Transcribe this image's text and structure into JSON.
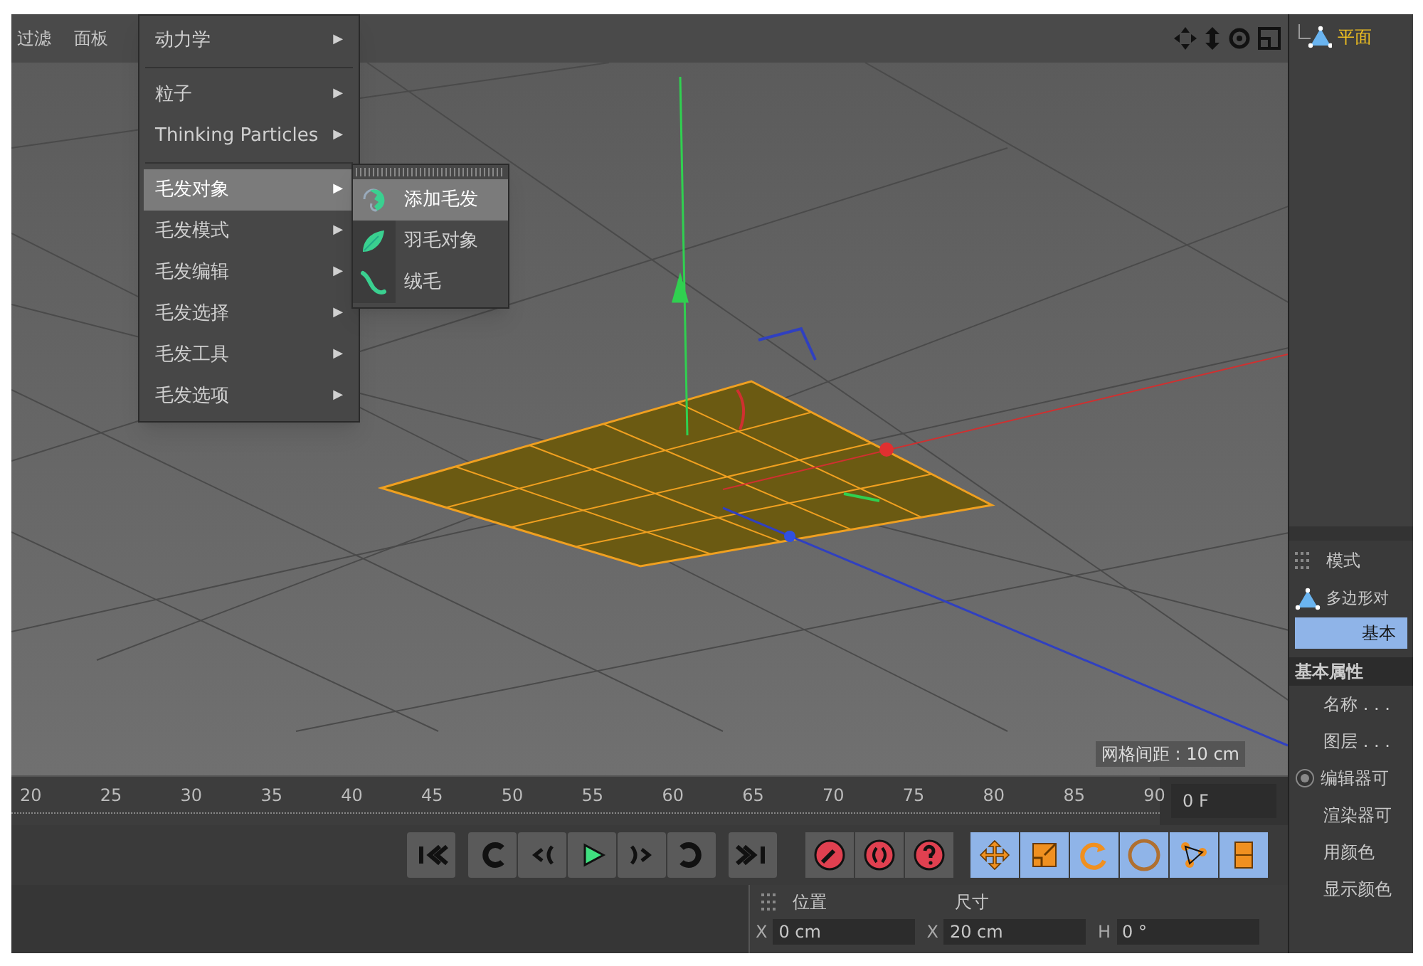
{
  "viewport": {
    "menu": [
      "过滤",
      "面板"
    ],
    "grid_spacing": "网格间距 : 10 cm"
  },
  "menu": {
    "groups": [
      [
        {
          "label": "动力学",
          "selected": false
        }
      ],
      [
        {
          "label": "粒子",
          "selected": false
        },
        {
          "label": "Thinking Particles",
          "selected": false
        }
      ],
      [
        {
          "label": "毛发对象",
          "selected": true
        },
        {
          "label": "毛发模式",
          "selected": false
        },
        {
          "label": "毛发编辑",
          "selected": false
        },
        {
          "label": "毛发选择",
          "selected": false
        },
        {
          "label": "毛发工具",
          "selected": false
        },
        {
          "label": "毛发选项",
          "selected": false
        }
      ]
    ],
    "arrow": "▶"
  },
  "submenu": [
    {
      "label": "添加毛发",
      "kind": "hair",
      "selected": true
    },
    {
      "label": "羽毛对象",
      "kind": "feather",
      "selected": false
    },
    {
      "label": "绒毛",
      "kind": "fur",
      "selected": false
    }
  ],
  "object_list": [
    {
      "label": "平面",
      "selected": true
    }
  ],
  "attributes": {
    "tab": "模式",
    "object": "多边形对",
    "tabs": [
      {
        "label": "基本",
        "selected": true
      }
    ],
    "section": "基本属性",
    "fields": [
      {
        "label": "名称 . . .",
        "kind": "text"
      },
      {
        "label": "图层 . . .",
        "kind": "text"
      },
      {
        "label": "编辑器可",
        "kind": "radio",
        "checked": true
      },
      {
        "label": "渲染器可",
        "kind": "text"
      },
      {
        "label": "用颜色",
        "kind": "text"
      },
      {
        "label": "显示颜色",
        "kind": "text"
      }
    ]
  },
  "timeline": {
    "ticks": [
      "20",
      "25",
      "30",
      "35",
      "40",
      "45",
      "50",
      "55",
      "60",
      "65",
      "70",
      "75",
      "80",
      "85",
      "90"
    ],
    "frame": "0 F"
  },
  "transport": [
    {
      "kind": "first"
    },
    {
      "kind": "prev_key"
    },
    {
      "kind": "prev_frame"
    },
    {
      "kind": "play"
    },
    {
      "kind": "next_frame"
    },
    {
      "kind": "next_key"
    },
    {
      "kind": "last"
    }
  ],
  "key_buttons": [
    {
      "kind": "record"
    },
    {
      "kind": "auto"
    },
    {
      "kind": "help"
    }
  ],
  "mode_buttons": [
    {
      "kind": "move"
    },
    {
      "kind": "scale"
    },
    {
      "kind": "rotate"
    },
    {
      "kind": "param"
    },
    {
      "kind": "point"
    },
    {
      "kind": "grid"
    }
  ],
  "coordinates": {
    "headers": [
      "位置",
      "尺寸"
    ],
    "fields": [
      {
        "axis": "X",
        "value": "0 cm"
      },
      {
        "axis": "X",
        "value": "20 cm"
      },
      {
        "axis": "H",
        "value": "0 °"
      }
    ]
  }
}
